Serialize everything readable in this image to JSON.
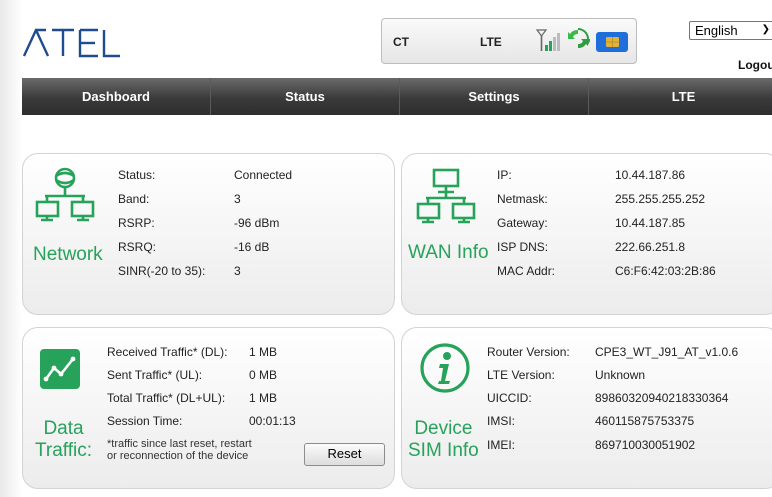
{
  "header": {
    "logo_text": "ATEL",
    "carrier": "CT",
    "network_type": "LTE",
    "language": "English",
    "logout_label": "Logout"
  },
  "nav": {
    "items": [
      {
        "label": "Dashboard"
      },
      {
        "label": "Status"
      },
      {
        "label": "Settings"
      },
      {
        "label": "LTE"
      }
    ]
  },
  "network": {
    "title": "Network",
    "rows": [
      {
        "label": "Status:",
        "value": "Connected"
      },
      {
        "label": "Band:",
        "value": "3"
      },
      {
        "label": "RSRP:",
        "value": "-96 dBm"
      },
      {
        "label": "RSRQ:",
        "value": "-16 dB"
      },
      {
        "label": "SINR(-20 to 35):",
        "value": "3"
      }
    ]
  },
  "wan": {
    "title": "WAN Info",
    "rows": [
      {
        "label": "IP:",
        "value": "10.44.187.86"
      },
      {
        "label": "Netmask:",
        "value": "255.255.255.252"
      },
      {
        "label": "Gateway:",
        "value": "10.44.187.85"
      },
      {
        "label": "ISP DNS:",
        "value": "222.66.251.8"
      },
      {
        "label": "MAC Addr:",
        "value": "C6:F6:42:03:2B:86"
      }
    ]
  },
  "data_traffic": {
    "title_line1": "Data",
    "title_line2": "Traffic:",
    "rows": [
      {
        "label": "Received Traffic* (DL):",
        "value": "1 MB"
      },
      {
        "label": "Sent Traffic* (UL):",
        "value": "0 MB"
      },
      {
        "label": "Total Traffic* (DL+UL):",
        "value": "1 MB"
      },
      {
        "label": "Session Time:",
        "value": "00:01:13"
      }
    ],
    "note_line1": "*traffic since last reset, restart",
    "note_line2": "or reconnection of the device",
    "reset_label": "Reset"
  },
  "device": {
    "title_line1": "Device",
    "title_line2": "SIM Info",
    "rows": [
      {
        "label": "Router Version:",
        "value": "CPE3_WT_J91_AT_v1.0.6"
      },
      {
        "label": "LTE Version:",
        "value": "Unknown"
      },
      {
        "label": "UICCID:",
        "value": "89860320940218330364"
      },
      {
        "label": "IMSI:",
        "value": "460115875753375"
      },
      {
        "label": "IMEI:",
        "value": "869710030051902"
      }
    ]
  },
  "colors": {
    "accent_green": "#27a25b",
    "navbar_dark": "#3a3a3a",
    "sim_blue": "#1e6fd9",
    "sim_gold": "#e2b23a"
  },
  "icons": [
    "atel-logo",
    "signal-icon",
    "refresh-icon",
    "sim-card-icon",
    "network-icon",
    "wan-icon",
    "chart-icon",
    "info-icon"
  ]
}
